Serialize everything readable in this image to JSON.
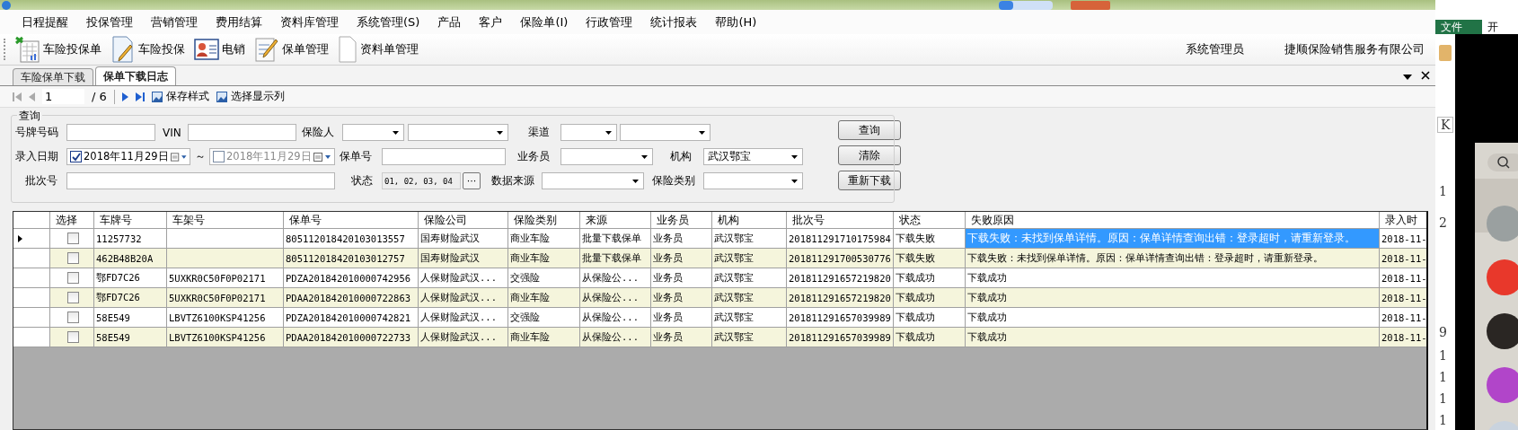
{
  "menu": [
    "日程提醒",
    "投保管理",
    "营销管理",
    "费用结算",
    "资料库管理",
    "系统管理(S)",
    "产品",
    "客户",
    "保险单(I)",
    "行政管理",
    "统计报表",
    "帮助(H)"
  ],
  "toolbar": [
    {
      "kind": "sheet",
      "label": "车险投保单"
    },
    {
      "kind": "doc-pencil",
      "label": "车险投保"
    },
    {
      "kind": "card",
      "label": "电销"
    },
    {
      "kind": "notes",
      "label": "保单管理"
    },
    {
      "kind": "doc",
      "label": "资料单管理"
    }
  ],
  "user": {
    "name": "系统管理员",
    "company": "捷顺保险销售服务有限公司"
  },
  "tabs": [
    {
      "label": "车险保单下载",
      "selected": false
    },
    {
      "label": "保单下载日志",
      "selected": true
    }
  ],
  "pager": {
    "page": "1",
    "total": "/ 6",
    "actions": [
      "保存样式",
      "选择显示列"
    ]
  },
  "query": {
    "title": "查询",
    "rows": [
      [
        {
          "label": "号牌号码",
          "kind": "input"
        },
        {
          "label": "VIN",
          "kind": "input"
        },
        {
          "label": "保险人",
          "kind": "select-pair"
        },
        {
          "label": "渠道",
          "kind": "select-pair"
        }
      ],
      [
        {
          "label": "录入日期",
          "kind": "date-range",
          "separator": "～",
          "dates": [
            {
              "value": "2018年11月29日",
              "checked": true
            },
            {
              "value": "2018年11月29日",
              "checked": false
            }
          ]
        },
        {
          "label": "保单号",
          "kind": "input"
        },
        {
          "label": "业务员",
          "kind": "select"
        },
        {
          "label": "机构",
          "kind": "select",
          "value": "武汉鄂宝"
        }
      ],
      [
        {
          "label": "批次号",
          "kind": "input"
        },
        {
          "label": "状态",
          "kind": "picker",
          "value": "01, 02, 03, 04",
          "button": "···"
        },
        {
          "label": "数据来源",
          "kind": "select"
        },
        {
          "label": "保险类别",
          "kind": "select"
        }
      ]
    ],
    "buttons": [
      "查询",
      "清除",
      "重新下载"
    ]
  },
  "table": {
    "check_label": "选择",
    "columns": [
      {
        "label": "车牌号"
      },
      {
        "label": "车架号"
      },
      {
        "label": "保单号"
      },
      {
        "label": "保险公司"
      },
      {
        "label": "保险类别"
      },
      {
        "label": "来源"
      },
      {
        "label": "业务员"
      },
      {
        "label": "机构"
      },
      {
        "label": "批次号"
      },
      {
        "label": "状态"
      },
      {
        "label": "失败原因",
        "focus": true
      },
      {
        "label": "录入时"
      }
    ],
    "rows": [
      {
        "selected": true,
        "checked": false,
        "cells": [
          "11257732",
          "",
          "805112018420103013557",
          "国寿财险武汉",
          "商业车险",
          "批量下载保单",
          "业务员",
          "武汉鄂宝",
          "201811291710175984",
          "下载失败",
          "下载失败：未找到保单详情。原因：保单详情查询出错：登录超时，请重新登录。",
          "2018-11-"
        ]
      },
      {
        "selected": false,
        "checked": false,
        "cells": [
          "462B48B20A",
          "",
          "805112018420103012757",
          "国寿财险武汉",
          "商业车险",
          "批量下载保单",
          "业务员",
          "武汉鄂宝",
          "201811291700530776",
          "下载失败",
          "下载失败：未找到保单详情。原因：保单详情查询出错：登录超时，请重新登录。",
          "2018-11-"
        ]
      },
      {
        "selected": false,
        "checked": false,
        "cells": [
          "鄂FD7C26",
          "5UXKR0C50F0P02171",
          "PDZA201842010000742956",
          "人保财险武汉...",
          "交强险",
          "从保险公...",
          "业务员",
          "武汉鄂宝",
          "201811291657219820",
          "下载成功",
          "下载成功",
          "2018-11-"
        ]
      },
      {
        "selected": false,
        "checked": false,
        "cells": [
          "鄂FD7C26",
          "5UXKR0C50F0P02171",
          "PDAA201842010000722863",
          "人保财险武汉...",
          "商业车险",
          "从保险公...",
          "业务员",
          "武汉鄂宝",
          "201811291657219820",
          "下载成功",
          "下载成功",
          "2018-11-"
        ]
      },
      {
        "selected": false,
        "checked": false,
        "cells": [
          "58E549",
          "LBVTZ6100KSP41256",
          "PDZA201842010000742821",
          "人保财险武汉...",
          "交强险",
          "从保险公...",
          "业务员",
          "武汉鄂宝",
          "201811291657039989",
          "下载成功",
          "下载成功",
          "2018-11-"
        ]
      },
      {
        "selected": false,
        "checked": false,
        "cells": [
          "58E549",
          "LBVTZ6100KSP41256",
          "PDAA201842010000722733",
          "人保财险武汉...",
          "商业车险",
          "从保险公...",
          "业务员",
          "武汉鄂宝",
          "201811291657039989",
          "下载成功",
          "下载成功",
          "2018-11-"
        ]
      }
    ]
  },
  "side": {
    "tabs": [
      "文件",
      "开"
    ],
    "cells": [
      "K",
      "1",
      "2",
      "9",
      "1",
      "1",
      "1",
      "1"
    ]
  }
}
